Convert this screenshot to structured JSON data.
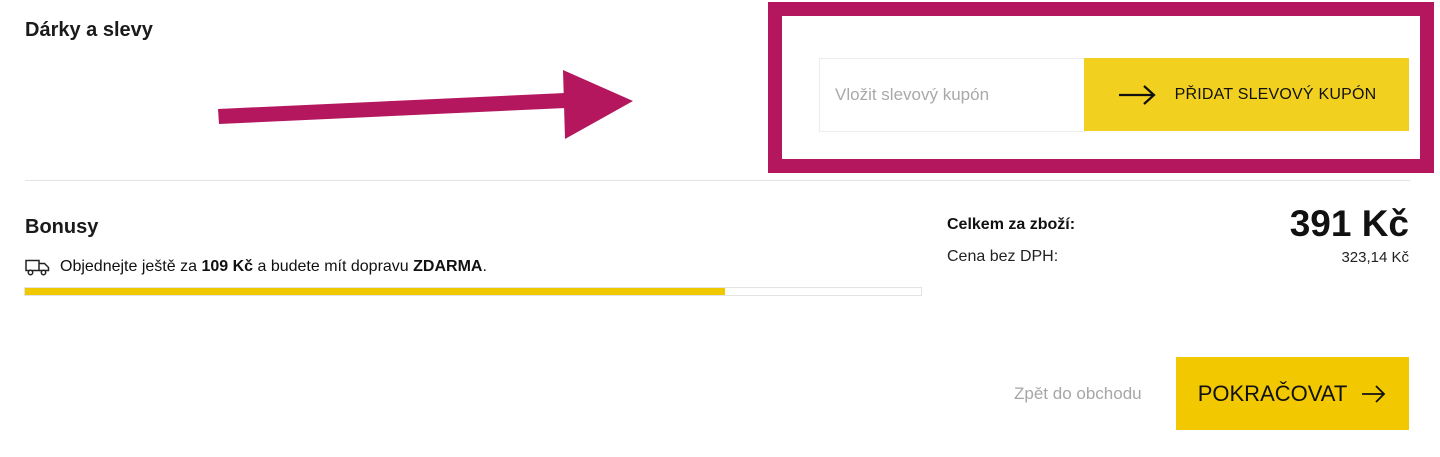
{
  "gifts": {
    "title": "Dárky a slevy",
    "coupon_placeholder": "Vložit slevový kupón",
    "coupon_value": "",
    "add_coupon_label": "PŘIDAT SLEVOVÝ KUPÓN"
  },
  "annotation": {
    "color": "#b5175f",
    "arrow_icon": "annotation-arrow",
    "highlight_box_color": "#b5175f"
  },
  "bonus": {
    "title": "Bonusy",
    "icon": "truck-icon",
    "text_before": "Objednejte ještě za",
    "amount": "109 Kč",
    "text_middle": "a budete mít dopravu",
    "free_label": "ZDARMA",
    "text_end": ".",
    "progress_fraction": 0.781,
    "progress_color": "#f0c800"
  },
  "totals": {
    "total_label": "Celkem za zboží:",
    "total_value": "391 Kč",
    "net_label": "Cena bez DPH:",
    "net_value": "323,14 Kč"
  },
  "actions": {
    "back_label": "Zpět do obchodu",
    "continue_label": "POKRAČOVAT",
    "accent_color": "#f2c800"
  }
}
